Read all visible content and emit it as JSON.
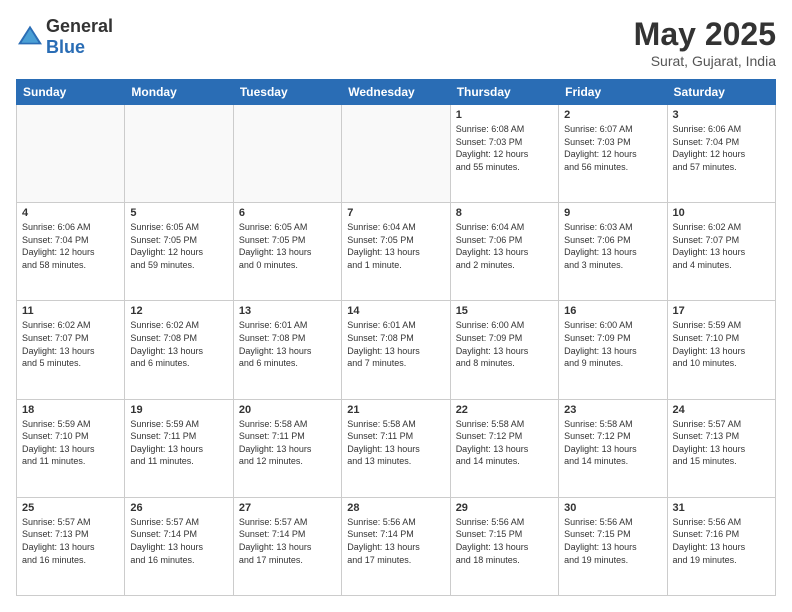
{
  "header": {
    "logo_general": "General",
    "logo_blue": "Blue",
    "month_title": "May 2025",
    "location": "Surat, Gujarat, India"
  },
  "weekdays": [
    "Sunday",
    "Monday",
    "Tuesday",
    "Wednesday",
    "Thursday",
    "Friday",
    "Saturday"
  ],
  "weeks": [
    [
      {
        "day": "",
        "info": ""
      },
      {
        "day": "",
        "info": ""
      },
      {
        "day": "",
        "info": ""
      },
      {
        "day": "",
        "info": ""
      },
      {
        "day": "1",
        "info": "Sunrise: 6:08 AM\nSunset: 7:03 PM\nDaylight: 12 hours\nand 55 minutes."
      },
      {
        "day": "2",
        "info": "Sunrise: 6:07 AM\nSunset: 7:03 PM\nDaylight: 12 hours\nand 56 minutes."
      },
      {
        "day": "3",
        "info": "Sunrise: 6:06 AM\nSunset: 7:04 PM\nDaylight: 12 hours\nand 57 minutes."
      }
    ],
    [
      {
        "day": "4",
        "info": "Sunrise: 6:06 AM\nSunset: 7:04 PM\nDaylight: 12 hours\nand 58 minutes."
      },
      {
        "day": "5",
        "info": "Sunrise: 6:05 AM\nSunset: 7:05 PM\nDaylight: 12 hours\nand 59 minutes."
      },
      {
        "day": "6",
        "info": "Sunrise: 6:05 AM\nSunset: 7:05 PM\nDaylight: 13 hours\nand 0 minutes."
      },
      {
        "day": "7",
        "info": "Sunrise: 6:04 AM\nSunset: 7:05 PM\nDaylight: 13 hours\nand 1 minute."
      },
      {
        "day": "8",
        "info": "Sunrise: 6:04 AM\nSunset: 7:06 PM\nDaylight: 13 hours\nand 2 minutes."
      },
      {
        "day": "9",
        "info": "Sunrise: 6:03 AM\nSunset: 7:06 PM\nDaylight: 13 hours\nand 3 minutes."
      },
      {
        "day": "10",
        "info": "Sunrise: 6:02 AM\nSunset: 7:07 PM\nDaylight: 13 hours\nand 4 minutes."
      }
    ],
    [
      {
        "day": "11",
        "info": "Sunrise: 6:02 AM\nSunset: 7:07 PM\nDaylight: 13 hours\nand 5 minutes."
      },
      {
        "day": "12",
        "info": "Sunrise: 6:02 AM\nSunset: 7:08 PM\nDaylight: 13 hours\nand 6 minutes."
      },
      {
        "day": "13",
        "info": "Sunrise: 6:01 AM\nSunset: 7:08 PM\nDaylight: 13 hours\nand 6 minutes."
      },
      {
        "day": "14",
        "info": "Sunrise: 6:01 AM\nSunset: 7:08 PM\nDaylight: 13 hours\nand 7 minutes."
      },
      {
        "day": "15",
        "info": "Sunrise: 6:00 AM\nSunset: 7:09 PM\nDaylight: 13 hours\nand 8 minutes."
      },
      {
        "day": "16",
        "info": "Sunrise: 6:00 AM\nSunset: 7:09 PM\nDaylight: 13 hours\nand 9 minutes."
      },
      {
        "day": "17",
        "info": "Sunrise: 5:59 AM\nSunset: 7:10 PM\nDaylight: 13 hours\nand 10 minutes."
      }
    ],
    [
      {
        "day": "18",
        "info": "Sunrise: 5:59 AM\nSunset: 7:10 PM\nDaylight: 13 hours\nand 11 minutes."
      },
      {
        "day": "19",
        "info": "Sunrise: 5:59 AM\nSunset: 7:11 PM\nDaylight: 13 hours\nand 11 minutes."
      },
      {
        "day": "20",
        "info": "Sunrise: 5:58 AM\nSunset: 7:11 PM\nDaylight: 13 hours\nand 12 minutes."
      },
      {
        "day": "21",
        "info": "Sunrise: 5:58 AM\nSunset: 7:11 PM\nDaylight: 13 hours\nand 13 minutes."
      },
      {
        "day": "22",
        "info": "Sunrise: 5:58 AM\nSunset: 7:12 PM\nDaylight: 13 hours\nand 14 minutes."
      },
      {
        "day": "23",
        "info": "Sunrise: 5:58 AM\nSunset: 7:12 PM\nDaylight: 13 hours\nand 14 minutes."
      },
      {
        "day": "24",
        "info": "Sunrise: 5:57 AM\nSunset: 7:13 PM\nDaylight: 13 hours\nand 15 minutes."
      }
    ],
    [
      {
        "day": "25",
        "info": "Sunrise: 5:57 AM\nSunset: 7:13 PM\nDaylight: 13 hours\nand 16 minutes."
      },
      {
        "day": "26",
        "info": "Sunrise: 5:57 AM\nSunset: 7:14 PM\nDaylight: 13 hours\nand 16 minutes."
      },
      {
        "day": "27",
        "info": "Sunrise: 5:57 AM\nSunset: 7:14 PM\nDaylight: 13 hours\nand 17 minutes."
      },
      {
        "day": "28",
        "info": "Sunrise: 5:56 AM\nSunset: 7:14 PM\nDaylight: 13 hours\nand 17 minutes."
      },
      {
        "day": "29",
        "info": "Sunrise: 5:56 AM\nSunset: 7:15 PM\nDaylight: 13 hours\nand 18 minutes."
      },
      {
        "day": "30",
        "info": "Sunrise: 5:56 AM\nSunset: 7:15 PM\nDaylight: 13 hours\nand 19 minutes."
      },
      {
        "day": "31",
        "info": "Sunrise: 5:56 AM\nSunset: 7:16 PM\nDaylight: 13 hours\nand 19 minutes."
      }
    ]
  ]
}
